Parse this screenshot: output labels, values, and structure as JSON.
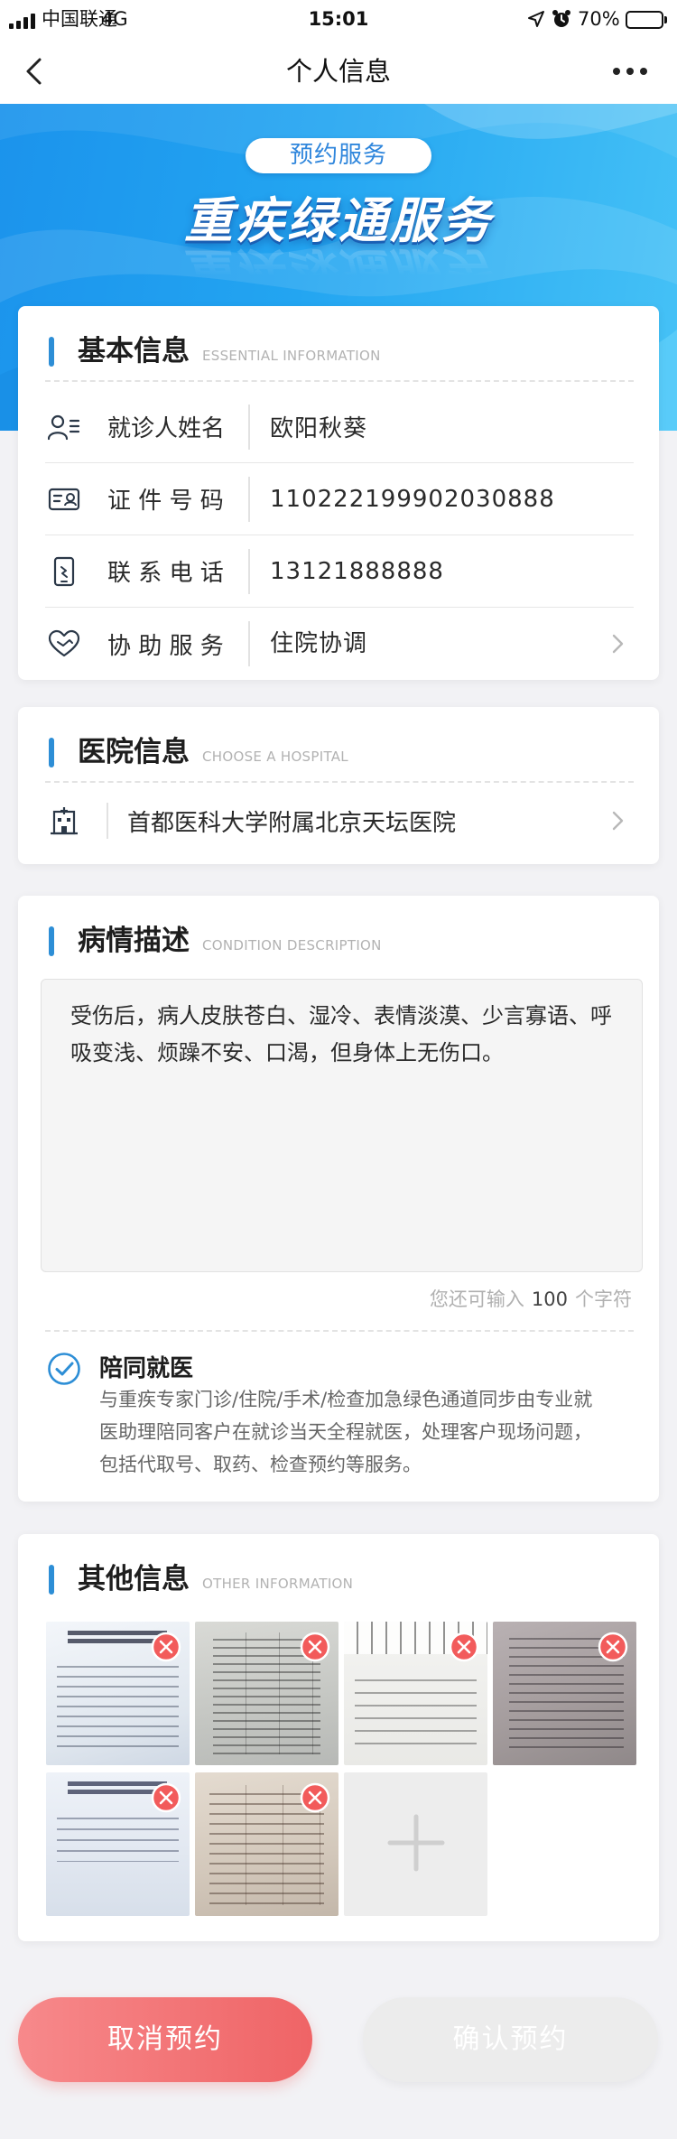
{
  "status_bar": {
    "carrier": "中国联通",
    "network": "4G",
    "time": "15:01",
    "battery_percent": "70%",
    "battery_level": 0.7
  },
  "nav": {
    "title": "个人信息"
  },
  "hero": {
    "badge": "预约服务",
    "title": "重疾绿通服务"
  },
  "basic_info": {
    "title": "基本信息",
    "subtitle": "ESSENTIAL INFORMATION",
    "rows": [
      {
        "icon": "user-icon",
        "label": "就诊人姓名",
        "value": "欧阳秋葵"
      },
      {
        "icon": "id-card-icon",
        "label": "证 件 号 码",
        "value": "110222199902030888"
      },
      {
        "icon": "phone-icon",
        "label": "联 系 电 话",
        "value": "13121888888"
      },
      {
        "icon": "heart-hand-icon",
        "label": "协 助 服 务",
        "value": "住院协调"
      }
    ]
  },
  "hospital_info": {
    "title": "医院信息",
    "subtitle": "CHOOSE A HOSPITAL",
    "icon": "hospital-icon",
    "hospital_name": "首都医科大学附属北京天坛医院"
  },
  "condition": {
    "title": "病情描述",
    "subtitle": "CONDITION DESCRIPTION",
    "description": "受伤后，病人皮肤苍白、湿冷、表情淡漠、少言寡语、呼吸变浅、烦躁不安、口渴，但身体上无伤口。",
    "counter": {
      "prefix": "您还可输入",
      "value": "100",
      "suffix": "个字符"
    },
    "escort": {
      "checked": true,
      "title": "陪同就医",
      "description_lines": [
        "与重疾专家门诊/住院/手术/检查加急绿色通道同步由专业就",
        "医助理陪同客户在就诊当天全程就医，处理客户现场问题，",
        "包括代取号、取药、检查预约等服务。"
      ]
    }
  },
  "other_info": {
    "title": "其他信息",
    "subtitle": "OTHER INFORMATION",
    "delete_icon": "close-icon",
    "add_icon": "plus-icon"
  },
  "actions": {
    "cancel": "取消预约",
    "confirm": "确认预约",
    "confirm_enabled": false
  },
  "colors": {
    "accent": "#2d8ed6",
    "hero_blue": "#1b93ec",
    "cancel_button": "#ef6466",
    "delete_badge": "#f25b5b",
    "disabled_button": "#ececec"
  }
}
